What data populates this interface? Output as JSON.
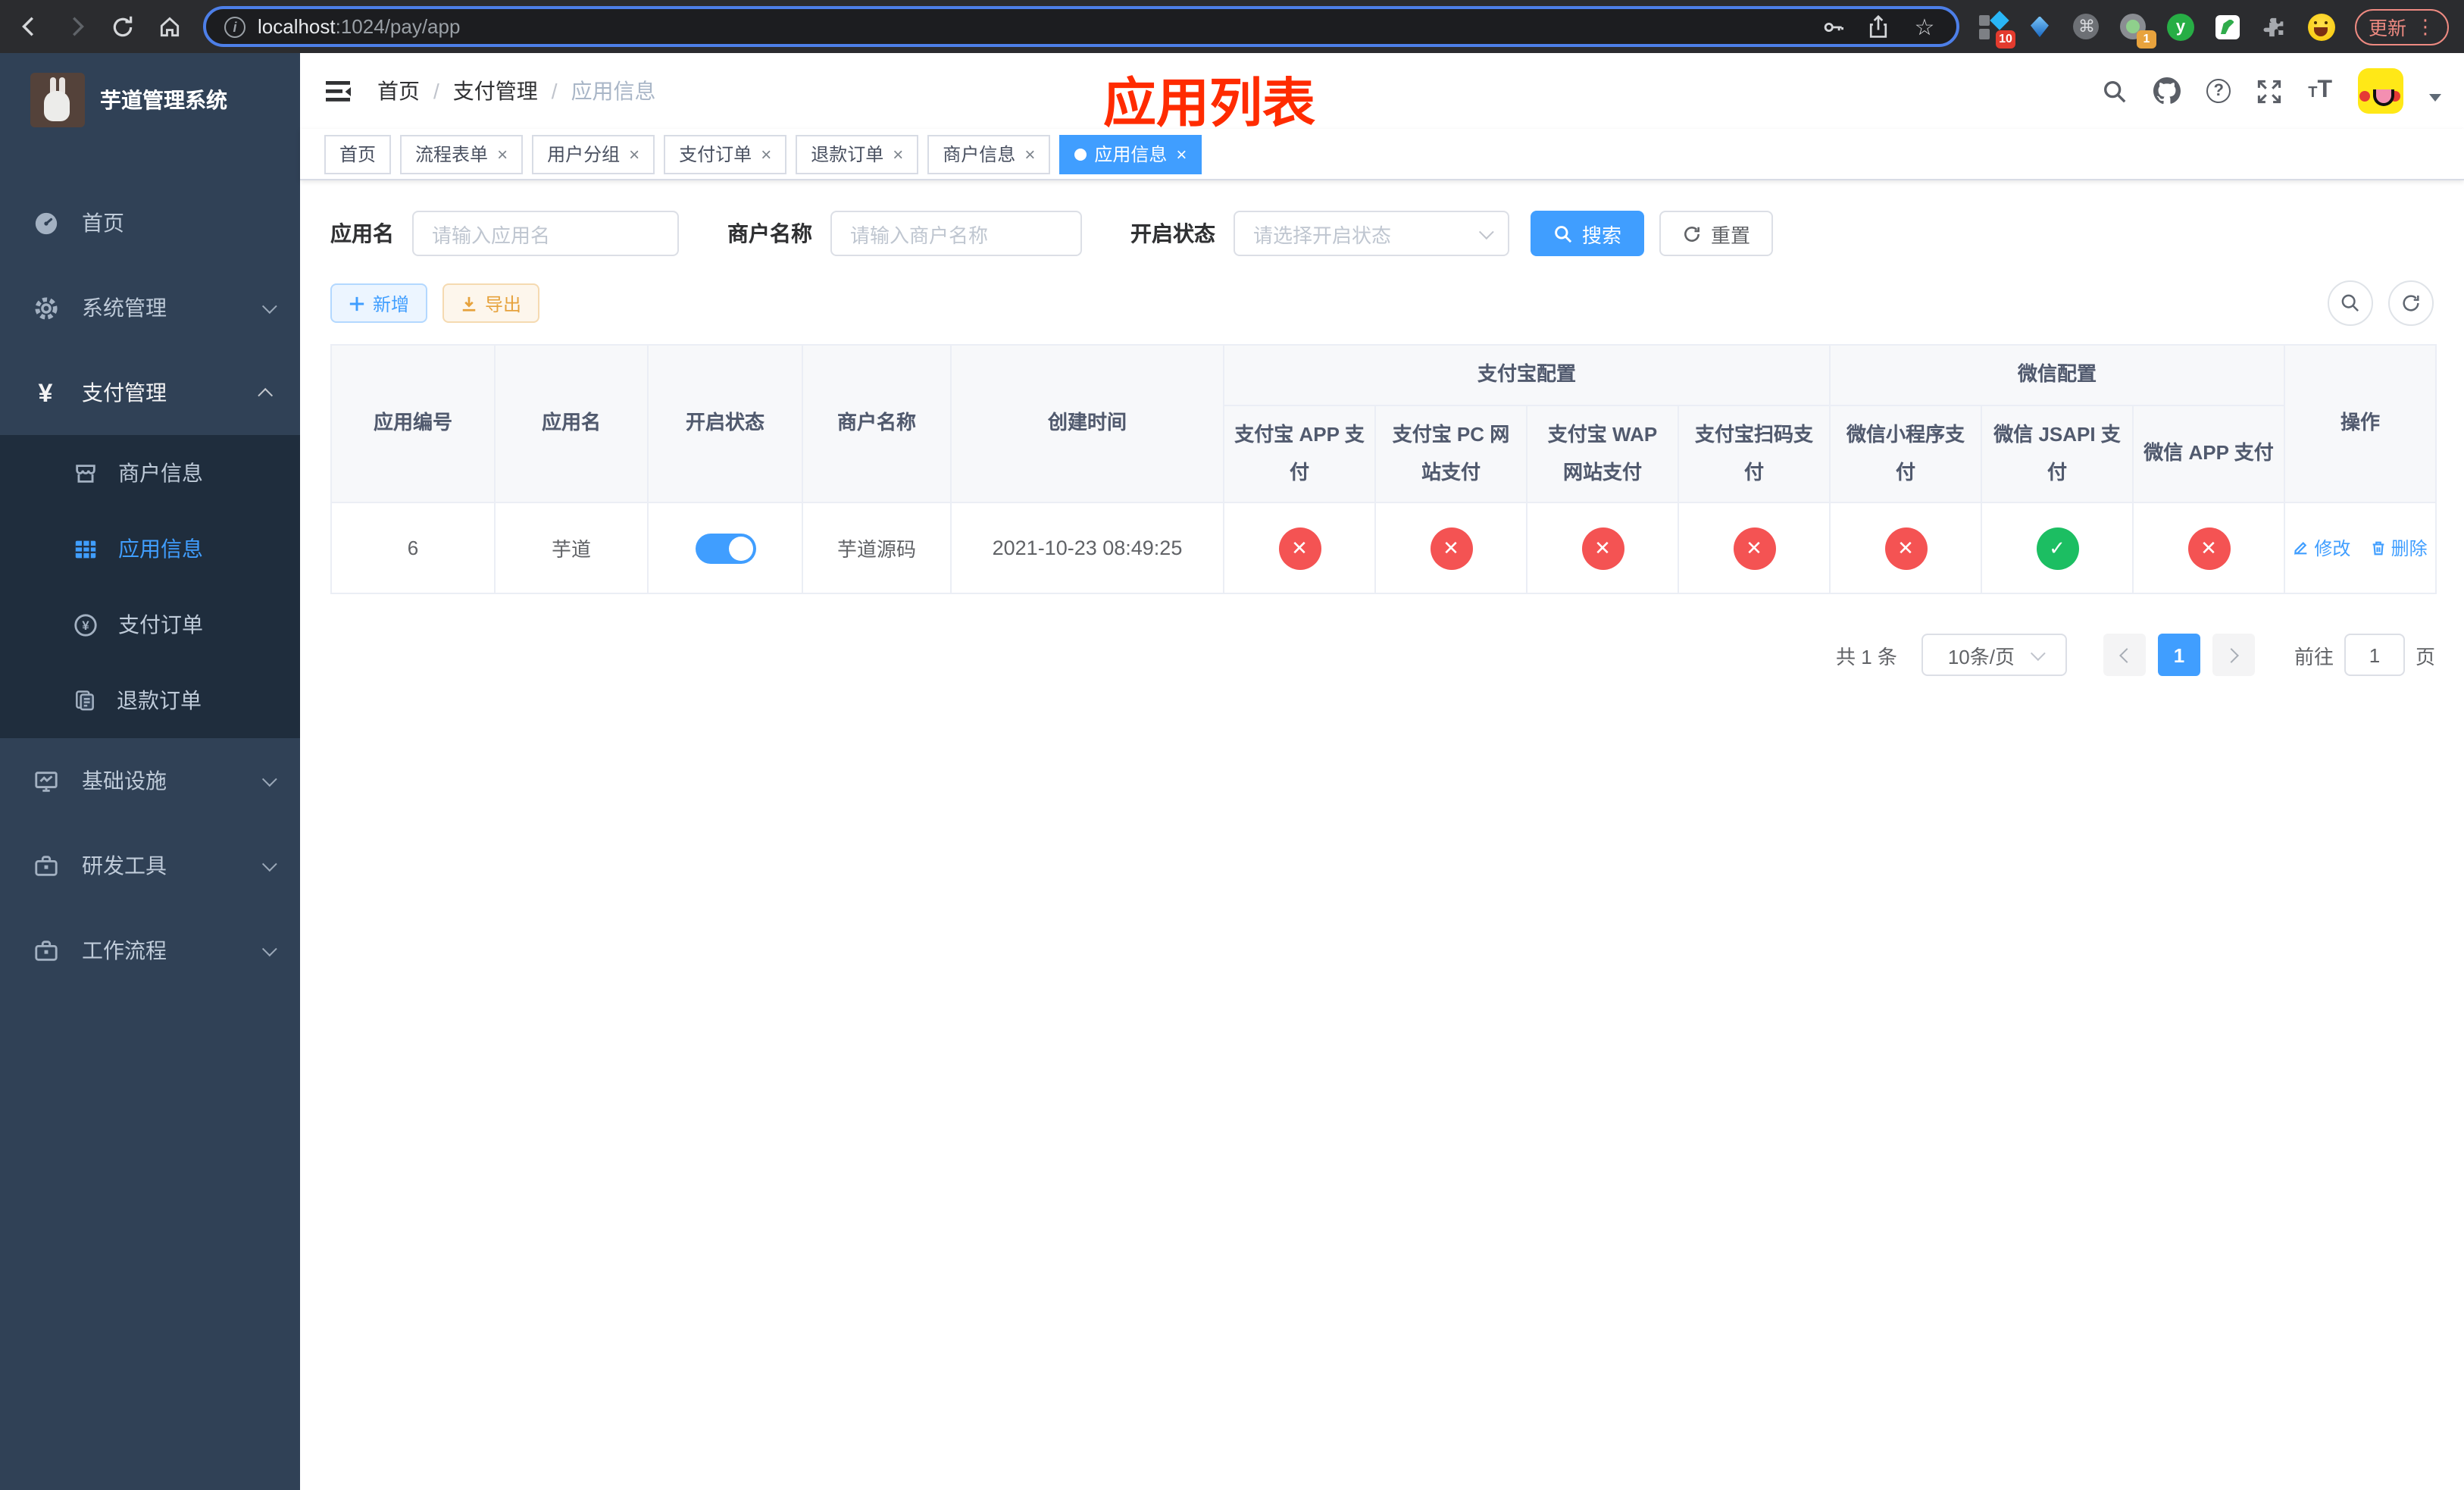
{
  "browser": {
    "url_host": "localhost",
    "url_rest": ":1024/pay/app",
    "update_label": "更新",
    "ext_badge_diamond": "10",
    "ext_badge_dot": "1",
    "ext_y_letter": "y"
  },
  "glyphs": {
    "slash": "/",
    "close": "×",
    "check": "✓",
    "cross": "✕",
    "yen": "¥",
    "cmd": "⌘",
    "star": "☆",
    "info": "i",
    "question": "?",
    "font_small": "T",
    "font_big": "T",
    "dots": "⋮"
  },
  "sidebar": {
    "title": "芋道管理系统",
    "items": [
      {
        "label": "首页"
      },
      {
        "label": "系统管理"
      },
      {
        "label": "支付管理"
      },
      {
        "label": "商户信息"
      },
      {
        "label": "应用信息"
      },
      {
        "label": "支付订单"
      },
      {
        "label": "退款订单"
      },
      {
        "label": "基础设施"
      },
      {
        "label": "研发工具"
      },
      {
        "label": "工作流程"
      }
    ]
  },
  "header": {
    "breadcrumb": [
      "首页",
      "支付管理",
      "应用信息"
    ],
    "annotation": "应用列表"
  },
  "tabs": [
    {
      "label": "首页",
      "closable": false,
      "active": false
    },
    {
      "label": "流程表单",
      "closable": true,
      "active": false
    },
    {
      "label": "用户分组",
      "closable": true,
      "active": false
    },
    {
      "label": "支付订单",
      "closable": true,
      "active": false
    },
    {
      "label": "退款订单",
      "closable": true,
      "active": false
    },
    {
      "label": "商户信息",
      "closable": true,
      "active": false
    },
    {
      "label": "应用信息",
      "closable": true,
      "active": true
    }
  ],
  "search": {
    "app_label": "应用名",
    "app_placeholder": "请输入应用名",
    "merchant_label": "商户名称",
    "merchant_placeholder": "请输入商户名称",
    "status_label": "开启状态",
    "status_placeholder": "请选择开启状态",
    "search_button": "搜索",
    "reset_button": "重置"
  },
  "toolbar": {
    "add_label": "新增",
    "export_label": "导出"
  },
  "table": {
    "columns_left": [
      "应用编号",
      "应用名",
      "开启状态",
      "商户名称",
      "创建时间"
    ],
    "group_alipay": "支付宝配置",
    "group_wechat": "微信配置",
    "columns_alipay": [
      "支付宝 APP 支付",
      "支付宝 PC 网站支付",
      "支付宝 WAP 网站支付",
      "支付宝扫码支付"
    ],
    "columns_wechat": [
      "微信小程序支付",
      "微信 JSAPI 支付",
      "微信 APP 支付"
    ],
    "column_actions": "操作",
    "row": {
      "id": "6",
      "name": "芋道",
      "enabled": true,
      "merchant": "芋道源码",
      "created": "2021-10-23 08:49:25",
      "configs": [
        false,
        false,
        false,
        false,
        false,
        true,
        false
      ],
      "actions": [
        "修改",
        "删除"
      ]
    }
  },
  "pagination": {
    "total": "共 1 条",
    "page_size": "10条/页",
    "current": "1",
    "goto_prefix": "前往",
    "goto_value": "1",
    "goto_suffix": "页"
  },
  "colors": {
    "primary": "#409eff",
    "success": "#1cbe62",
    "danger": "#f45353",
    "warning": "#e6a23c",
    "annotation": "#ff2b00",
    "sidebar_bg": "#304156",
    "submenu_bg": "#1f2d3d"
  }
}
